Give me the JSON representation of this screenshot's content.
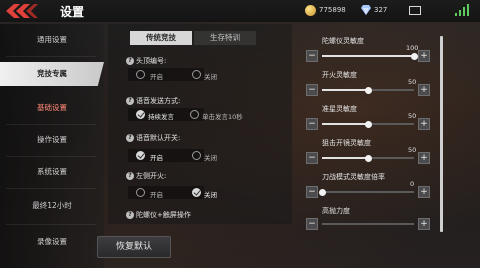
{
  "header": {
    "title": "设置",
    "gold": "775898",
    "diamonds": "327",
    "icons": [
      "back-chevron-icon",
      "gold-coin-icon",
      "diamond-icon",
      "mail-icon",
      "signal-icon"
    ]
  },
  "sidebar": {
    "items": [
      {
        "label": "通用设置"
      },
      {
        "label": "竞技专属"
      },
      {
        "label": "基础设置"
      },
      {
        "label": "操作设置"
      },
      {
        "label": "系统设置"
      },
      {
        "label": "最终12小时"
      },
      {
        "label": "录像设置"
      }
    ],
    "active_index": 1,
    "reset_label": "恢复默认"
  },
  "tabs": [
    {
      "label": "传统竞技",
      "active": true
    },
    {
      "label": "生存特训",
      "active": false
    }
  ],
  "settings": [
    {
      "label": "头顶编号:",
      "options": [
        {
          "label": "开启",
          "selected": false
        },
        {
          "label": "关闭",
          "selected": false
        }
      ]
    },
    {
      "label": "语音发送方式:",
      "options": [
        {
          "label": "持续发言",
          "selected": true
        },
        {
          "label": "单击发言10秒",
          "selected": false
        }
      ]
    },
    {
      "label": "语音默认开关:",
      "options": [
        {
          "label": "开启",
          "selected": true
        },
        {
          "label": "关闭",
          "selected": false
        }
      ]
    },
    {
      "label": "左侧开火:",
      "options": [
        {
          "label": "开启",
          "selected": false
        },
        {
          "label": "关闭",
          "selected": true
        }
      ]
    },
    {
      "label": "陀螺仪+触屏操作",
      "options": []
    }
  ],
  "sliders": [
    {
      "label": "陀螺仪灵敏度",
      "value": 100,
      "max": 100
    },
    {
      "label": "开火灵敏度",
      "value": 50,
      "max": 100
    },
    {
      "label": "准星灵敏度",
      "value": 50,
      "max": 100
    },
    {
      "label": "狙击开镜灵敏度",
      "value": 50,
      "max": 100
    },
    {
      "label": "刀战模式灵敏度倍率",
      "value": 0,
      "max": 100
    },
    {
      "label": "高抛力度",
      "value": null,
      "max": 100
    }
  ],
  "colors": {
    "accent": "#e0413a",
    "highlight_text": "#ff8a7a"
  }
}
